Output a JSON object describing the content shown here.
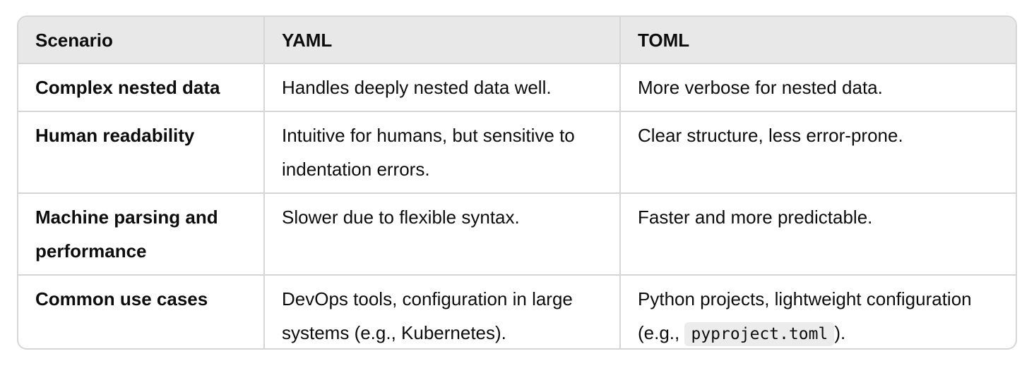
{
  "table": {
    "headers": [
      "Scenario",
      "YAML",
      "TOML"
    ],
    "rows": [
      {
        "scenario": "Complex nested data",
        "yaml": "Handles deeply nested data well.",
        "toml": "More verbose for nested data."
      },
      {
        "scenario": "Human readability",
        "yaml": "Intuitive for humans, but sensitive to indentation errors.",
        "toml": "Clear structure, less error-prone."
      },
      {
        "scenario": "Machine parsing and performance",
        "yaml": "Slower due to flexible syntax.",
        "toml": "Faster and more predictable."
      },
      {
        "scenario": "Common use cases",
        "yaml": "DevOps tools, configuration in large systems (e.g., Kubernetes).",
        "toml_prefix": "Python projects, lightweight configuration (e.g., ",
        "toml_code": "pyproject.toml",
        "toml_suffix": ")."
      }
    ]
  }
}
